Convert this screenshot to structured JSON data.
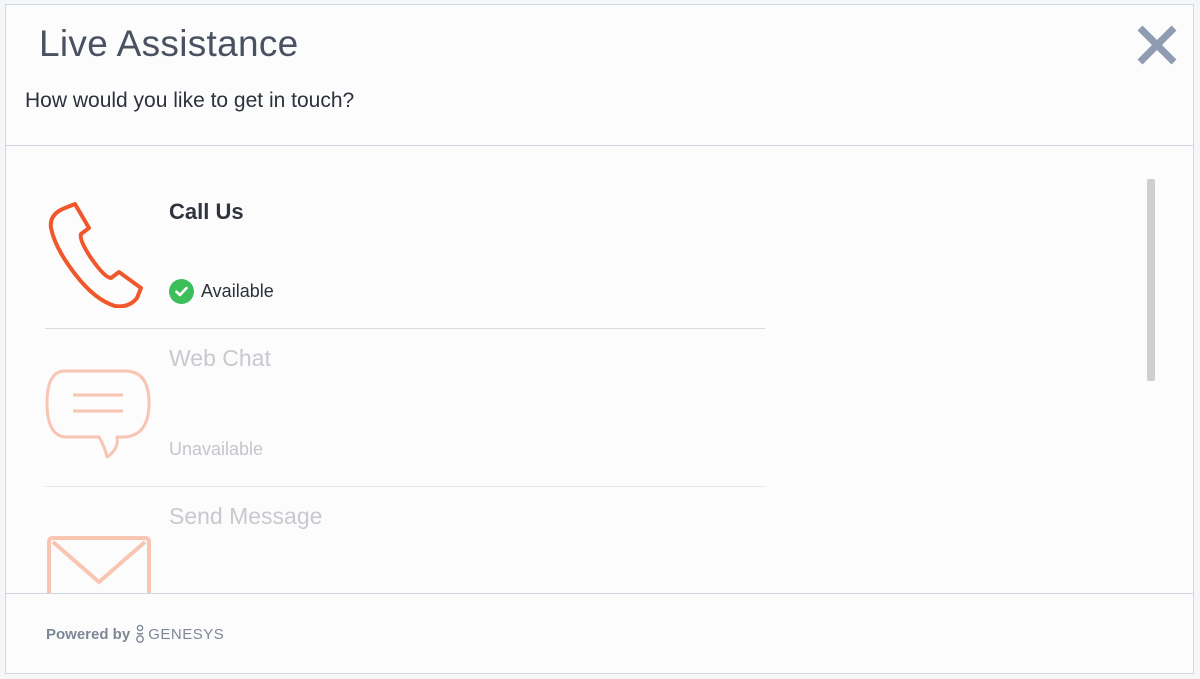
{
  "header": {
    "title": "Live Assistance",
    "subtitle": "How would you like to get in touch?",
    "close_icon": "close-icon"
  },
  "options": [
    {
      "title": "Call Us",
      "status": "Available",
      "icon": "phone-icon",
      "state": "available"
    },
    {
      "title": "Web Chat",
      "status": "Unavailable",
      "icon": "chat-bubble-icon",
      "state": "unavailable"
    },
    {
      "title": "Send Message",
      "status": "",
      "icon": "envelope-icon",
      "state": "unavailable"
    }
  ],
  "footer": {
    "powered_by": "Powered by",
    "brand": "GENESYS",
    "brand_icon": "genesys-logo-icon"
  },
  "colors": {
    "accent": "#f0572a",
    "accent_faded": "#f8c5b3",
    "available": "#3cbf5b",
    "close": "#8e9bb0"
  }
}
